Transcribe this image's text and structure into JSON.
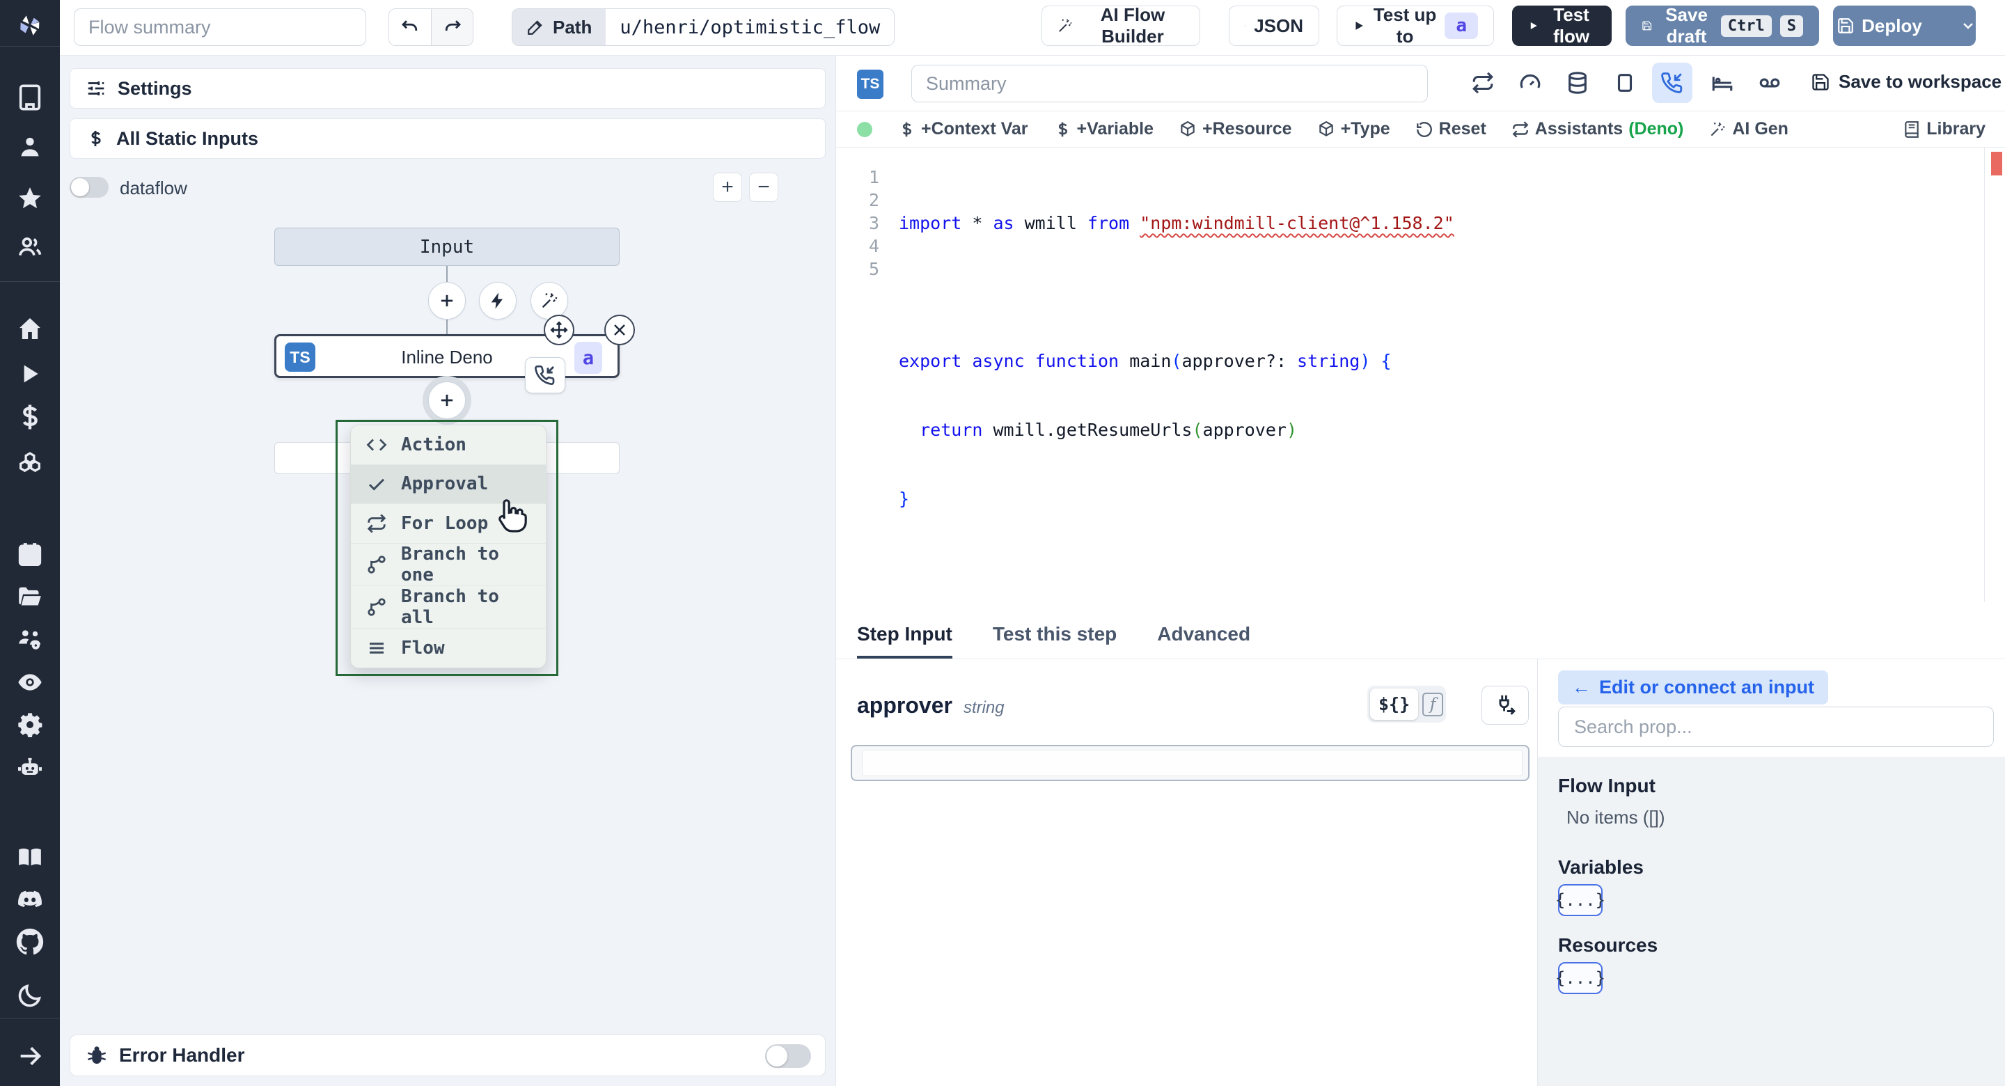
{
  "palette": {
    "sidebar_bg": "#212836",
    "slate_button": "#6884aa",
    "dark_button": "#232b3a",
    "selection_green": "#266939",
    "badge_indigo_bg": "#dfe3fd",
    "badge_indigo_text": "#4f46e5",
    "error_overview_red": "#e96a60",
    "green_dot": "#8ce0a6",
    "deno_green": "#16a34a",
    "active_icon_blue": "#2f6bdb"
  },
  "sidebar": {
    "icons": [
      "windmill-logo",
      "building",
      "user",
      "star",
      "users",
      "home",
      "play",
      "dollar-sign",
      "boxes",
      "calendar",
      "folder-open",
      "users-cog",
      "eye",
      "settings-gear",
      "bot",
      "book-open",
      "discord",
      "github",
      "moon",
      "arrow-right"
    ]
  },
  "topbar": {
    "flow_summary_placeholder": "Flow summary",
    "path_label": "Path",
    "path_value": "u/henri/optimistic_flow",
    "ai_flow_builder": "AI Flow Builder",
    "json": "JSON",
    "test_up_to": "Test up to",
    "test_up_to_badge": "a",
    "test_flow": "Test flow",
    "save_draft": "Save draft",
    "kbd_ctrl": "Ctrl",
    "kbd_s": "S",
    "deploy": "Deploy"
  },
  "settings_panel": {
    "settings": "Settings",
    "all_static_inputs": "All Static Inputs",
    "dataflow": "dataflow",
    "zoom_in": "+",
    "zoom_out": "−"
  },
  "graph": {
    "input_node": "Input",
    "step_node": {
      "lang_badge": "TS",
      "title": "Inline Deno",
      "suffix_badge": "a"
    },
    "insert_menu": {
      "items": [
        {
          "icon": "code-icon",
          "label": "Action"
        },
        {
          "icon": "check-icon",
          "label": "Approval"
        },
        {
          "icon": "repeat-icon",
          "label": "For Loop"
        },
        {
          "icon": "git-branch-icon",
          "label": "Branch to one"
        },
        {
          "icon": "git-branch-icon",
          "label": "Branch to all"
        },
        {
          "icon": "lines-icon",
          "label": "Flow"
        }
      ]
    },
    "error_handler": "Error Handler"
  },
  "editor": {
    "lang_badge": "TS",
    "summary_placeholder": "Summary",
    "save_to_workspace": "Save to workspace",
    "toolbar": {
      "context_var": "+Context Var",
      "variable": "+Variable",
      "resource": "+Resource",
      "type": "+Type",
      "reset": "Reset",
      "assistants": "Assistants",
      "assistants_lang": "(Deno)",
      "ai_gen": "AI Gen",
      "library": "Library"
    },
    "line_numbers": [
      "1",
      "2",
      "3",
      "4",
      "5"
    ],
    "code_lines": [
      [
        [
          "kw",
          "import"
        ],
        [
          "pl",
          " * "
        ],
        [
          "kw",
          "as"
        ],
        [
          "pl",
          " wmill "
        ],
        [
          "kw",
          "from"
        ],
        [
          "pl",
          " "
        ],
        [
          "str",
          "\"npm:windmill-client@^1.158.2\""
        ]
      ],
      [],
      [
        [
          "kw",
          "export"
        ],
        [
          "pl",
          " "
        ],
        [
          "kw",
          "async"
        ],
        [
          "pl",
          " "
        ],
        [
          "kw",
          "function"
        ],
        [
          "pl",
          " "
        ],
        [
          "fn",
          "main"
        ],
        [
          "p1",
          "("
        ],
        [
          "id",
          "approver"
        ],
        [
          "pl",
          "?: "
        ],
        [
          "kw",
          "string"
        ],
        [
          "p1",
          ")"
        ],
        [
          "pl",
          " "
        ],
        [
          "p1",
          "{"
        ]
      ],
      [
        [
          "pl",
          "  "
        ],
        [
          "kw",
          "return"
        ],
        [
          "pl",
          " wmill."
        ],
        [
          "fn",
          "getResumeUrls"
        ],
        [
          "p3",
          "("
        ],
        [
          "id",
          "approver"
        ],
        [
          "p3",
          ")"
        ]
      ],
      [
        [
          "p1",
          "}"
        ]
      ]
    ]
  },
  "step_panel": {
    "tabs": [
      "Step Input",
      "Test this step",
      "Advanced"
    ],
    "field_name": "approver",
    "field_type": "string",
    "expr_toggle_label": "${}",
    "fn_toggle_label": "f"
  },
  "connect_panel": {
    "back_arrow": "←",
    "back_label": "Edit or connect an input",
    "search_placeholder": "Search prop...",
    "flow_input_heading": "Flow Input",
    "flow_input_empty": "No items ([])",
    "variables_heading": "Variables",
    "resources_heading": "Resources",
    "object_button": "{...}"
  }
}
